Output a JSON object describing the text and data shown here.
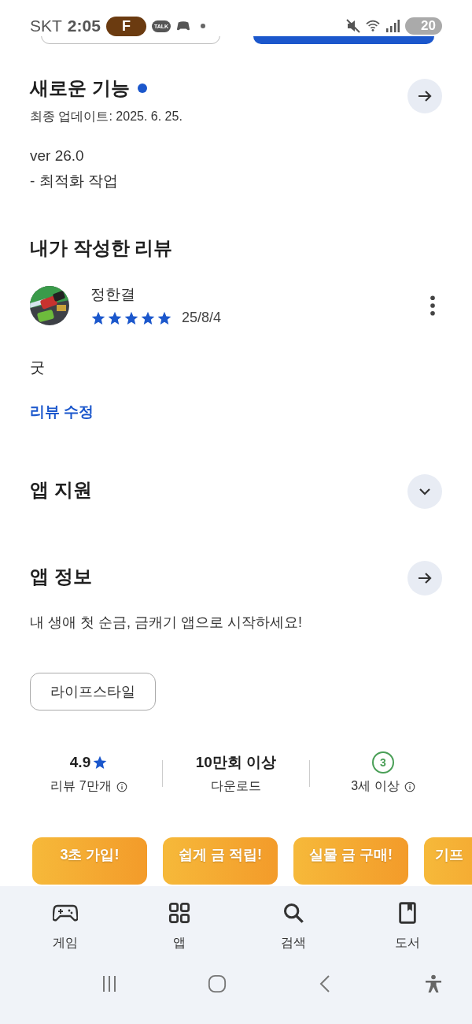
{
  "status_bar": {
    "carrier": "SKT",
    "time": "2:05",
    "app_badge": "F",
    "talk_label": "TALK",
    "battery": "20"
  },
  "whats_new": {
    "title": "새로운 기능",
    "updated": "최종 업데이트: 2025. 6. 25.",
    "version": "ver 26.0",
    "notes": "- 최적화 작업"
  },
  "my_review": {
    "title": "내가 작성한 리뷰",
    "author": "정한결",
    "stars": 5,
    "date": "25/8/4",
    "text": "굿",
    "edit_link": "리뷰 수정"
  },
  "app_support": {
    "title": "앱 지원",
    "expanded": false
  },
  "app_info": {
    "title": "앱 정보",
    "description": "내 생애 첫 순금, 금캐기 앱으로 시작하세요!",
    "category": "라이프스타일"
  },
  "stats": [
    {
      "kind": "rating",
      "value": "4.9",
      "label": "리뷰 7만개"
    },
    {
      "kind": "plain",
      "value": "10만회 이상",
      "label": "다운로드"
    },
    {
      "kind": "age",
      "value": "3",
      "label": "3세 이상"
    }
  ],
  "banners": [
    "3초 가입!",
    "쉽게 금 적립!",
    "실물 금 구매!",
    "기프"
  ],
  "nav": [
    {
      "label": "게임",
      "selected": false
    },
    {
      "label": "앱",
      "selected": false
    },
    {
      "label": "검색",
      "selected": false
    },
    {
      "label": "도서",
      "selected": false
    }
  ]
}
